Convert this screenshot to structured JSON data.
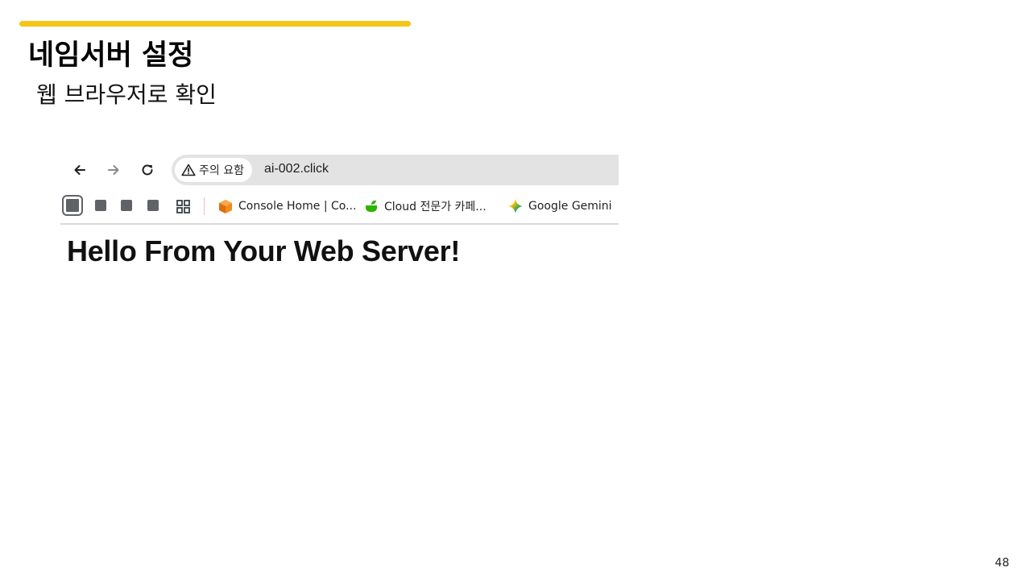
{
  "slide": {
    "title": "네임서버 설정",
    "subtitle": "웹 브라우저로 확인",
    "page_number": "48",
    "accent_color": "#F5C518"
  },
  "browser": {
    "nav": {
      "back_icon": "arrow-left-icon",
      "forward_icon": "arrow-right-icon",
      "reload_icon": "reload-icon"
    },
    "address_bar": {
      "security_label": "주의 요함",
      "security_icon": "warning-triangle-icon",
      "url": "ai-002.click"
    },
    "bookmarks_bar": {
      "items": [
        {
          "label": "Console Home | Co...",
          "icon": "aws-cube-icon",
          "icon_color": "#F28A1E"
        },
        {
          "label": "Cloud 전문가 카페...",
          "icon": "green-leaf-cup-icon",
          "icon_color": "#2DB400"
        },
        {
          "label": "Google Gemini",
          "icon": "gemini-sparkle-icon",
          "icon_color": "#4285F4"
        }
      ]
    },
    "page": {
      "heading": "Hello From Your Web Server!"
    }
  }
}
